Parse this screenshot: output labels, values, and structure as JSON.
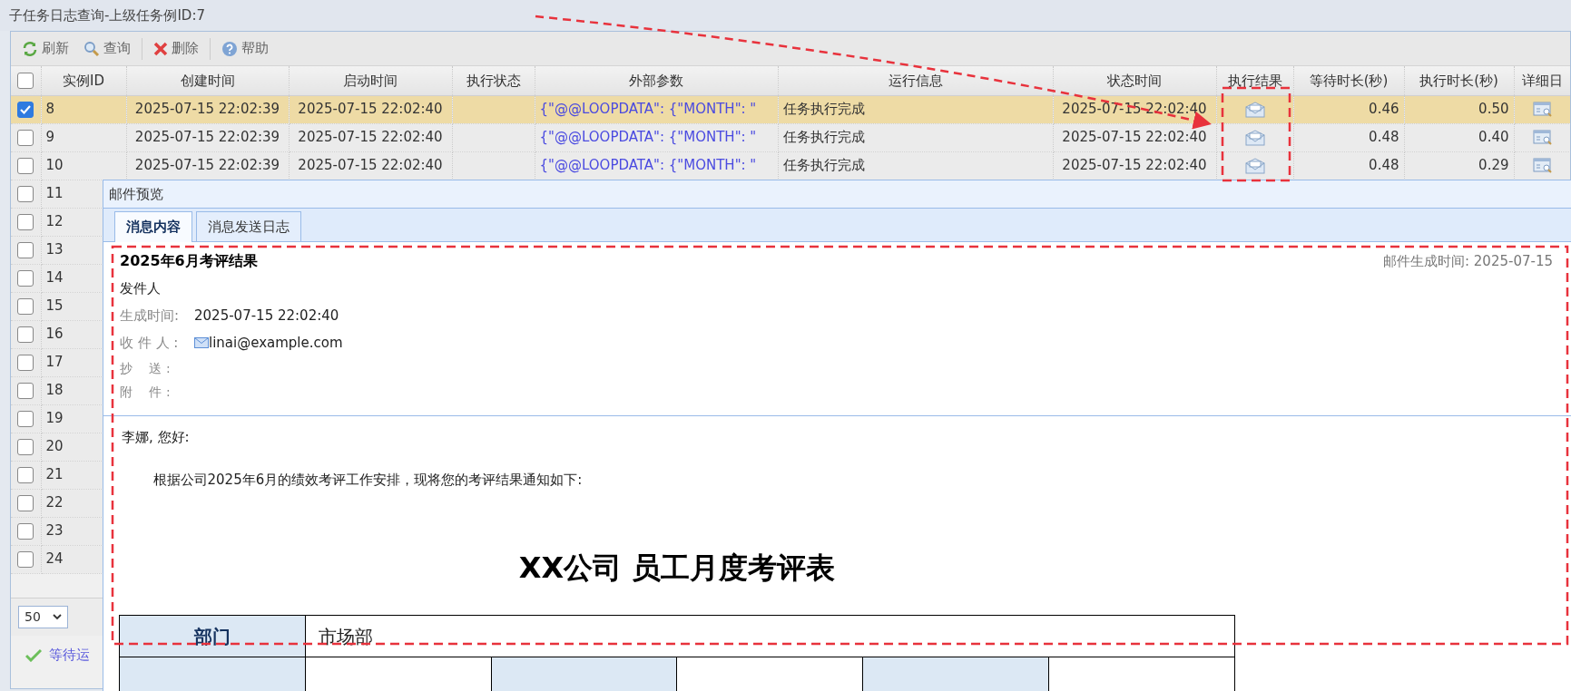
{
  "window": {
    "title": "子任务日志查询-上级任务例ID:7"
  },
  "toolbar": [
    {
      "label": "刷新",
      "kind": "refresh"
    },
    {
      "label": "查询",
      "kind": "search"
    },
    {
      "label": "删除",
      "kind": "delete"
    },
    {
      "label": "帮助",
      "kind": "help"
    }
  ],
  "table": {
    "header_checked": false,
    "columns": [
      {
        "label": "实例ID",
        "kind": "id"
      },
      {
        "label": "创建时间",
        "kind": "time"
      },
      {
        "label": "启动时间",
        "kind": "time"
      },
      {
        "label": "执行状态",
        "kind": "empty"
      },
      {
        "label": "外部参数",
        "kind": "params"
      },
      {
        "label": "运行信息",
        "kind": "text"
      },
      {
        "label": "状态时间",
        "kind": "time"
      },
      {
        "label": "执行结果",
        "kind": "envelope"
      },
      {
        "label": "等待时长(秒)",
        "kind": "number"
      },
      {
        "label": "执行时长(秒)",
        "kind": "number"
      },
      {
        "label": "详细日",
        "kind": "detail"
      }
    ],
    "rows": [
      {
        "checked": true,
        "selected": true,
        "cells": [
          "8",
          "2025-07-15 22:02:39",
          "2025-07-15 22:02:40",
          "",
          "{\"@@LOOPDATA\": {\"MONTH\": \"",
          "任务执行完成",
          "2025-07-15 22:02:40",
          "",
          "0.46",
          "0.50",
          ""
        ]
      },
      {
        "checked": false,
        "selected": false,
        "cells": [
          "9",
          "2025-07-15 22:02:39",
          "2025-07-15 22:02:40",
          "",
          "{\"@@LOOPDATA\": {\"MONTH\": \"",
          "任务执行完成",
          "2025-07-15 22:02:40",
          "",
          "0.48",
          "0.40",
          ""
        ]
      },
      {
        "checked": false,
        "selected": false,
        "cells": [
          "10",
          "2025-07-15 22:02:39",
          "2025-07-15 22:02:40",
          "",
          "{\"@@LOOPDATA\": {\"MONTH\": \"",
          "任务执行完成",
          "2025-07-15 22:02:40",
          "",
          "0.48",
          "0.29",
          ""
        ]
      },
      {
        "checked": false,
        "selected": false,
        "cells": [
          "11"
        ]
      },
      {
        "checked": false,
        "selected": false,
        "cells": [
          "12"
        ]
      },
      {
        "checked": false,
        "selected": false,
        "cells": [
          "13"
        ]
      },
      {
        "checked": false,
        "selected": false,
        "cells": [
          "14"
        ]
      },
      {
        "checked": false,
        "selected": false,
        "cells": [
          "15"
        ]
      },
      {
        "checked": false,
        "selected": false,
        "cells": [
          "16"
        ]
      },
      {
        "checked": false,
        "selected": false,
        "cells": [
          "17"
        ]
      },
      {
        "checked": false,
        "selected": false,
        "cells": [
          "18"
        ]
      },
      {
        "checked": false,
        "selected": false,
        "cells": [
          "19"
        ]
      },
      {
        "checked": false,
        "selected": false,
        "cells": [
          "20"
        ]
      },
      {
        "checked": false,
        "selected": false,
        "cells": [
          "21"
        ]
      },
      {
        "checked": false,
        "selected": false,
        "cells": [
          "22"
        ]
      },
      {
        "checked": false,
        "selected": false,
        "cells": [
          "23"
        ]
      },
      {
        "checked": false,
        "selected": false,
        "cells": [
          "24"
        ]
      }
    ]
  },
  "pager": {
    "page_size": "50"
  },
  "status_bar": {
    "text": "等待运"
  },
  "dialog": {
    "title": "邮件预览",
    "tabs": [
      {
        "label": "消息内容",
        "selected": true
      },
      {
        "label": "消息发送日志",
        "selected": false
      }
    ],
    "mail": {
      "subject": "2025年6月考评结果",
      "generated": "邮件生成时间: 2025-07-15",
      "sender": "发件人",
      "fields": [
        {
          "label": "生成时间:",
          "value": "2025-07-15 22:02:40",
          "kind": "text"
        },
        {
          "label": "收 件 人 :",
          "value": "linai@example.com",
          "kind": "email"
        },
        {
          "label": "抄　 送 :",
          "kind": "small"
        },
        {
          "label": "附　 件 :",
          "kind": "small"
        }
      ],
      "greeting": "李娜, 您好:",
      "paragraph": "根据公司2025年6月的绩效考评工作安排，现将您的考评结果通知如下:",
      "heading": "XX公司 员工月度考评表",
      "table": [
        [
          {
            "header": true,
            "text": "部门"
          },
          {
            "header": false,
            "text": "市场部"
          }
        ],
        [
          {
            "header": true
          },
          {
            "header": false
          },
          {
            "header": true
          },
          {
            "header": false
          },
          {
            "header": true
          },
          {
            "header": false
          }
        ]
      ]
    }
  },
  "annotations": [
    {
      "kind": "arrow"
    },
    {
      "kind": "box"
    },
    {
      "kind": "box"
    }
  ]
}
